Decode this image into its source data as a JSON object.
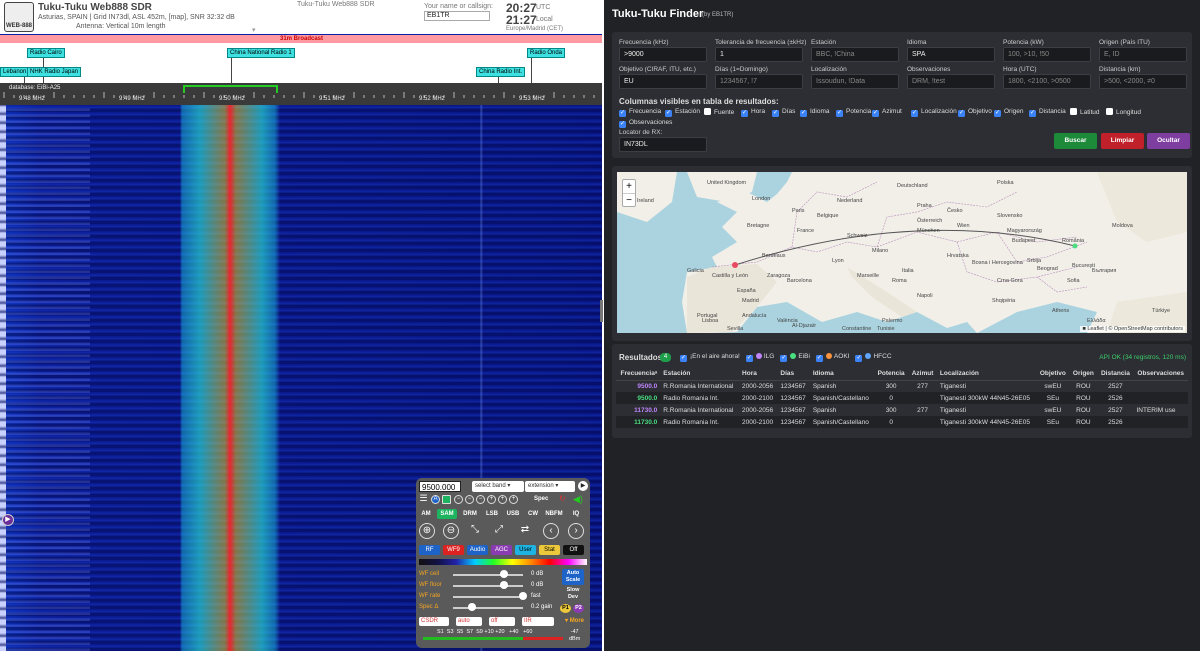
{
  "sdr": {
    "title": "Tuku-Tuku Web888 SDR",
    "location": "Asturias, SPAIN | Grid IN73dl, ASL 452m, [map], SNR 32:32 dB",
    "antenna": "Antenna: Vertical 10m length",
    "center_title": "Tuku-Tuku Web888 SDR",
    "logo_text": "WEB-888",
    "callsign_label": "Your name or callsign:",
    "callsign_value": "EB1TR",
    "utc_time": "20:27",
    "utc_label": "UTC",
    "local_time": "21:27",
    "local_label": "Local",
    "timezone": "Europe/Madrid (CET)",
    "band_label": "31m Broadcast",
    "database": "database: EiBi-A25",
    "station_labels": [
      "Radio Cairo",
      "Lebanon,",
      "NHK Radio Japan",
      "China National Radio 1",
      "Radio Onda",
      "China Radio Int."
    ],
    "mhz_labels": [
      "9.48 MHz",
      "9.49 MHz",
      "9.50 MHz",
      "9.51 MHz",
      "9.52 MHz",
      "9.53 MHz"
    ],
    "controls": {
      "frequency": "9500.000",
      "band_select": "select band",
      "extension_select": "extension",
      "spec_label": "Spec",
      "modes": [
        "AM",
        "SAM",
        "DRM",
        "LSB",
        "USB",
        "CW",
        "NBFM",
        "IQ"
      ],
      "active_mode": "SAM",
      "chips": [
        "RF",
        "WF9",
        "Audio",
        "AGC",
        "User",
        "Stat",
        "Off"
      ],
      "sliders": [
        {
          "label": "WF ceil",
          "value": "0 dB",
          "level": 0.73
        },
        {
          "label": "WF floor",
          "value": "0 dB",
          "level": 0.73
        },
        {
          "label": "WF rate",
          "value": "fast",
          "level": 1.0
        },
        {
          "label": "Spec Δ",
          "value": "0.2 gain",
          "level": 0.27
        }
      ],
      "autoscale": "Auto Scale",
      "slowdev": "Slow Dev",
      "p1": "P1",
      "p2": "P2",
      "selects": [
        "CSDR",
        "auto",
        "off",
        "IIR"
      ],
      "more": "More",
      "smeter_scale": "S1  S3  S5  S7  S9 +10 +20   +40   +60",
      "dbm_value": "-47",
      "dbm_unit": "dBm"
    }
  },
  "finder": {
    "title": "Tuku-Tuku Finder",
    "subtitle": "(by EB1TR)",
    "fields": [
      {
        "label": "Frecuencia (kHz)",
        "value": ">9000",
        "placeholder": false
      },
      {
        "label": "Tolerancia de frecuencia (±kHz)",
        "value": "1",
        "placeholder": false
      },
      {
        "label": "Estación",
        "value": "BBC, !China",
        "placeholder": true
      },
      {
        "label": "Idioma",
        "value": "SPA",
        "placeholder": false
      },
      {
        "label": "Potencia (kW)",
        "value": "100, >10, !50",
        "placeholder": true
      },
      {
        "label": "Origen (País ITU)",
        "value": "E, ID",
        "placeholder": true
      },
      {
        "label": "Objetivo (CIRAF, ITU, etc.)",
        "value": "EU",
        "placeholder": false
      },
      {
        "label": "Días (1=Domingo)",
        "value": "1234567, !7",
        "placeholder": true
      },
      {
        "label": "Localización",
        "value": "Issoudun, !Data",
        "placeholder": true
      },
      {
        "label": "Observaciones",
        "value": "DRM, !test",
        "placeholder": true
      },
      {
        "label": "Hora (UTC)",
        "value": "1800, <2100, >0500",
        "placeholder": true
      },
      {
        "label": "Distancia (km)",
        "value": ">500, <2000, ≠0",
        "placeholder": true
      }
    ],
    "columns_title": "Columnas visibles en tabla de resultados:",
    "columns": [
      {
        "label": "Frecuencia",
        "checked": true
      },
      {
        "label": "Estación",
        "checked": true
      },
      {
        "label": "Fuente",
        "checked": false
      },
      {
        "label": "Hora",
        "checked": true
      },
      {
        "label": "Días",
        "checked": true
      },
      {
        "label": "Idioma",
        "checked": true
      },
      {
        "label": "Potencia",
        "checked": true
      },
      {
        "label": "Azimut",
        "checked": true
      },
      {
        "label": "Localización",
        "checked": true
      },
      {
        "label": "Objetivo",
        "checked": true
      },
      {
        "label": "Origen",
        "checked": true
      },
      {
        "label": "Distancia",
        "checked": true
      },
      {
        "label": "Latitud",
        "checked": false
      },
      {
        "label": "Longitud",
        "checked": false
      },
      {
        "label": "Observaciones",
        "checked": true
      }
    ],
    "rx_label": "Locator de RX:",
    "rx_value": "IN73DL",
    "buttons": {
      "search": "Buscar",
      "clear": "Limpiar",
      "hide": "Ocultar"
    },
    "map": {
      "attribution": "■ Leaflet | © OpenStreetMap contributors",
      "labels": [
        "Ireland",
        "United Kingdom",
        "London",
        "Deutschland",
        "Polska",
        "France",
        "Paris",
        "Praha",
        "Česko",
        "Slovensko",
        "Österreich",
        "Schweiz",
        "Magyarország",
        "România",
        "Moldova",
        "Italia",
        "Roma",
        "España",
        "Madrid",
        "Portugal",
        "Lisboa",
        "Barcelona",
        "București",
        "България",
        "Ελλάδα",
        "Türkiye",
        "Al-Djazaïr",
        "Tunisie",
        "Srbija",
        "Crna Gora",
        "Bosna i Hercegovina",
        "Hrvatska",
        "Shqipëria",
        "Napoli",
        "Palermo",
        "Sevilla",
        "València",
        "Zaragoza",
        "Bordeaux",
        "Lyon",
        "Marseille",
        "Milano",
        "Beograd",
        "Sofia",
        "Budapest",
        "Wien",
        "München",
        "Nederland",
        "Belgique",
        "Bretagne",
        "Castilla y León",
        "Galicia",
        "Andalucía",
        "Constantine",
        "Athens"
      ]
    },
    "results": {
      "title": "Resultados",
      "count": "4",
      "live_label": "¡En el aire ahora!",
      "sources": [
        {
          "label": "ILG",
          "color": "#c084fc"
        },
        {
          "label": "EiBi",
          "color": "#4ade80"
        },
        {
          "label": "AOKI",
          "color": "#fb923c"
        },
        {
          "label": "HFCC",
          "color": "#60a5fa"
        }
      ],
      "api_status": "API OK (34 registros, 120 ms)",
      "headers": [
        "Frecuenciaᵃ",
        "Estación",
        "Hora",
        "Días",
        "Idioma",
        "Potencia",
        "Azimut",
        "Localización",
        "Objetivo",
        "Origen",
        "Distancia",
        "Observaciones"
      ],
      "rows": [
        {
          "freq": "9500.0",
          "color": "#c084fc",
          "station": "R.Romania International",
          "hora": "2000-2056",
          "dias": "1234567",
          "idioma": "Spanish",
          "potencia": "300",
          "azimut": "277",
          "loc": "Tiganesti",
          "obj": "swEU",
          "origen": "ROU",
          "dist": "2527",
          "obs": ""
        },
        {
          "freq": "9500.0",
          "color": "#4ade80",
          "station": "Radio Romania Int.",
          "hora": "2000-2100",
          "dias": "1234567",
          "idioma": "Spanish/Castellano",
          "potencia": "0",
          "azimut": "",
          "loc": "Tiganesti 300kW 44N45-26E05",
          "obj": "SEu",
          "origen": "ROU",
          "dist": "2526",
          "obs": ""
        },
        {
          "freq": "11730.0",
          "color": "#c084fc",
          "station": "R.Romania International",
          "hora": "2000-2056",
          "dias": "1234567",
          "idioma": "Spanish",
          "potencia": "300",
          "azimut": "277",
          "loc": "Tiganesti",
          "obj": "swEU",
          "origen": "ROU",
          "dist": "2527",
          "obs": "INTERIM use"
        },
        {
          "freq": "11730.0",
          "color": "#4ade80",
          "station": "Radio Romania Int.",
          "hora": "2000-2100",
          "dias": "1234567",
          "idioma": "Spanish/Castellano",
          "potencia": "0",
          "azimut": "",
          "loc": "Tiganesti 300kW 44N45-26E05",
          "obj": "SEu",
          "origen": "ROU",
          "dist": "2526",
          "obs": ""
        }
      ]
    }
  }
}
